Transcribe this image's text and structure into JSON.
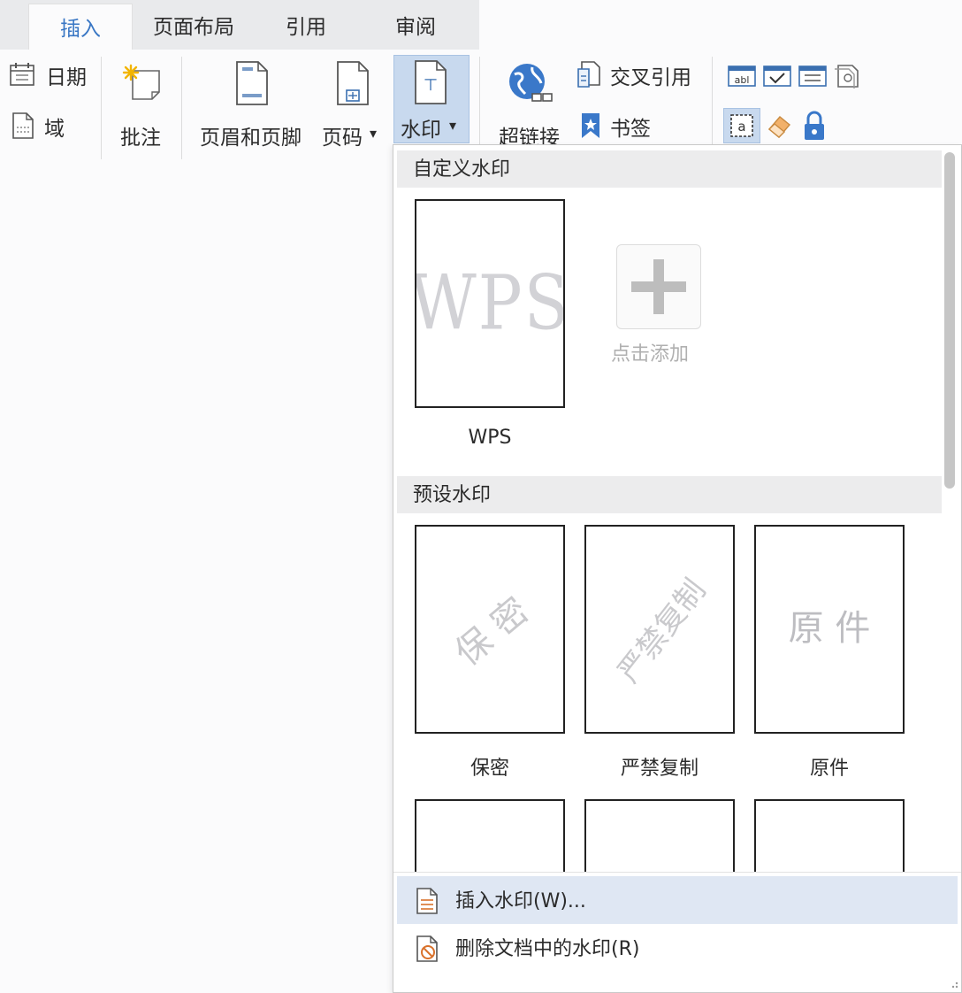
{
  "tabs": [
    {
      "label": "插入",
      "active": true
    },
    {
      "label": "页面布局",
      "active": false
    },
    {
      "label": "引用",
      "active": false
    },
    {
      "label": "审阅",
      "active": false
    }
  ],
  "ribbon": {
    "date_label": "日期",
    "field_label": "域",
    "comment_label": "批注",
    "header_footer_label": "页眉和页脚",
    "page_number_label": "页码",
    "watermark_label": "水印",
    "hyperlink_label": "超链接",
    "cross_ref_label": "交叉引用",
    "bookmark_label": "书签",
    "dropdown_arrow": "▾",
    "accent_color": "#3876c4"
  },
  "dropdown": {
    "custom_section": "自定义水印",
    "custom_items": [
      {
        "caption": "WPS",
        "watermark": "WPS"
      }
    ],
    "add_label": "点击添加",
    "preset_section": "预设水印",
    "preset_items": [
      {
        "caption": "保密",
        "watermark": "保 密"
      },
      {
        "caption": "严禁复制",
        "watermark": "严禁复制"
      },
      {
        "caption": "原件",
        "watermark": "原 件"
      }
    ],
    "menu": [
      {
        "label": "插入水印(W)...",
        "icon": "insert-watermark-icon"
      },
      {
        "label": "删除文档中的水印(R)",
        "icon": "delete-watermark-icon"
      }
    ]
  }
}
